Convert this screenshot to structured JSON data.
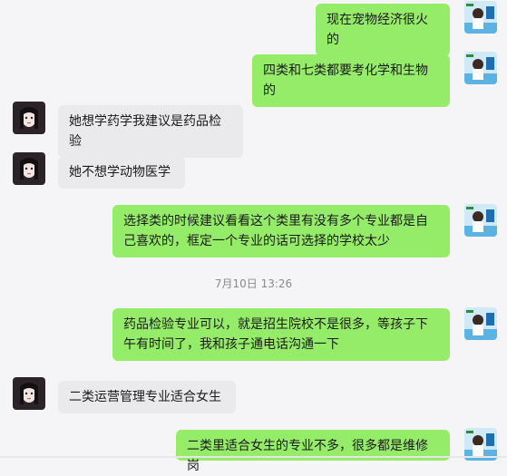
{
  "conversation": {
    "messages": [
      {
        "side": "right",
        "text": "现在宠物经济很火的"
      },
      {
        "side": "right",
        "text": "四类和七类都要考化学和生物的"
      },
      {
        "side": "left",
        "text": "她想学药学我建议是药品检验"
      },
      {
        "side": "left",
        "text": "她不想学动物医学"
      },
      {
        "side": "right",
        "text": "选择类的时候建议看看这个类里有没有多个专业都是自己喜欢的，框定一个专业的话可选择的学校太少"
      },
      {
        "side": "right",
        "text": "药品检验专业可以，就是招生院校不是很多，等孩子下午有时间了，我和孩子通电话沟通一下"
      },
      {
        "side": "left",
        "text": "二类运营管理专业适合女生"
      },
      {
        "side": "right",
        "text": "二类里适合女生的专业不多，很多都是维修岗"
      }
    ],
    "timestamp": "7月10日 13:26"
  },
  "colors": {
    "self_bubble": "#95ec69",
    "other_bubble": "#eaeaec",
    "background": "#f5f5f7"
  }
}
